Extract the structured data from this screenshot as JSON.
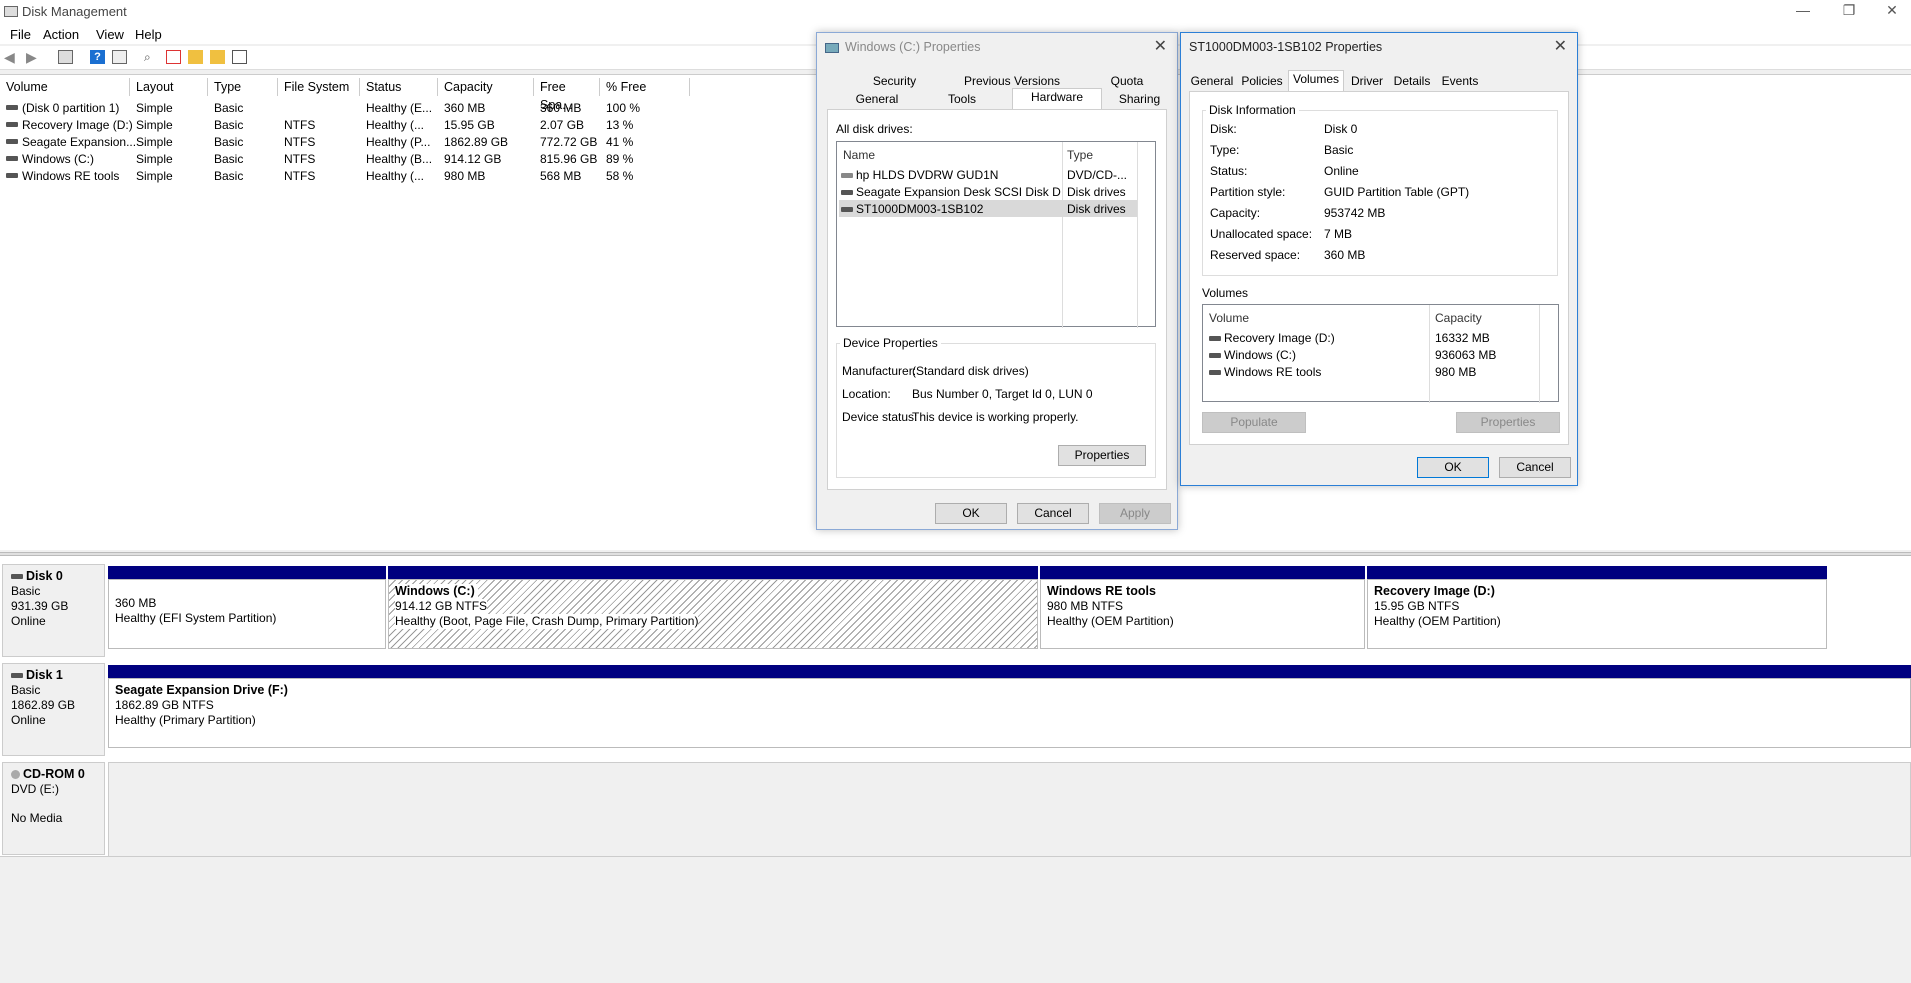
{
  "window": {
    "title": "Disk Management",
    "controls": [
      "—",
      "❐",
      "✕"
    ]
  },
  "menu": [
    "File",
    "Action",
    "View",
    "Help"
  ],
  "volume_list": {
    "headers": [
      "Volume",
      "Layout",
      "Type",
      "File System",
      "Status",
      "Capacity",
      "Free Spa...",
      "% Free"
    ],
    "rows": [
      [
        "(Disk 0 partition 1)",
        "Simple",
        "Basic",
        "",
        "Healthy (E...",
        "360 MB",
        "360 MB",
        "100 %"
      ],
      [
        "Recovery Image (D:)",
        "Simple",
        "Basic",
        "NTFS",
        "Healthy (...",
        "15.95 GB",
        "2.07 GB",
        "13 %"
      ],
      [
        "Seagate Expansion...",
        "Simple",
        "Basic",
        "NTFS",
        "Healthy (P...",
        "1862.89 GB",
        "772.72 GB",
        "41 %"
      ],
      [
        "Windows (C:)",
        "Simple",
        "Basic",
        "NTFS",
        "Healthy (B...",
        "914.12 GB",
        "815.96 GB",
        "89 %"
      ],
      [
        "Windows RE tools",
        "Simple",
        "Basic",
        "NTFS",
        "Healthy (...",
        "980 MB",
        "568 MB",
        "58 %"
      ]
    ]
  },
  "disks": {
    "disk0": {
      "name": "Disk 0",
      "type": "Basic",
      "size": "931.39 GB",
      "status": "Online",
      "partitions": [
        {
          "title": "",
          "size": "360 MB",
          "status": "Healthy (EFI System Partition)"
        },
        {
          "title": "Windows  (C:)",
          "size": "914.12 GB NTFS",
          "status": "Healthy (Boot, Page File, Crash Dump, Primary Partition)"
        },
        {
          "title": "Windows RE tools",
          "size": "980 MB NTFS",
          "status": "Healthy (OEM Partition)"
        },
        {
          "title": "Recovery Image  (D:)",
          "size": "15.95 GB NTFS",
          "status": "Healthy (OEM Partition)"
        }
      ]
    },
    "disk1": {
      "name": "Disk 1",
      "type": "Basic",
      "size": "1862.89 GB",
      "status": "Online",
      "partitions": [
        {
          "title": "Seagate Expansion Drive  (F:)",
          "size": "1862.89 GB NTFS",
          "status": "Healthy (Primary Partition)"
        }
      ]
    },
    "cdrom0": {
      "name": "CD-ROM 0",
      "type": "DVD (E:)",
      "status": "No Media"
    }
  },
  "dlg_c": {
    "title": "Windows (C:) Properties",
    "tabs_top": [
      "Security",
      "Previous Versions",
      "Quota"
    ],
    "tabs_bottom": [
      "General",
      "Tools",
      "Hardware",
      "Sharing"
    ],
    "all_drives_label": "All disk drives:",
    "headers": [
      "Name",
      "Type"
    ],
    "drives": [
      [
        "hp HLDS DVDRW  GUD1N",
        "DVD/CD-..."
      ],
      [
        "Seagate Expansion Desk SCSI Disk De...",
        "Disk drives"
      ],
      [
        "ST1000DM003-1SB102",
        "Disk drives"
      ]
    ],
    "device_props_label": "Device Properties",
    "manufacturer_label": "Manufacturer:",
    "manufacturer": "(Standard disk drives)",
    "location_label": "Location:",
    "location": "Bus Number 0, Target Id 0, LUN 0",
    "status_label": "Device status:",
    "status": "This device is working properly.",
    "properties_btn": "Properties",
    "ok": "OK",
    "cancel": "Cancel",
    "apply": "Apply"
  },
  "dlg_st": {
    "title": "ST1000DM003-1SB102 Properties",
    "tabs": [
      "General",
      "Policies",
      "Volumes",
      "Driver",
      "Details",
      "Events"
    ],
    "disk_info_label": "Disk Information",
    "info": [
      [
        "Disk:",
        "Disk 0"
      ],
      [
        "Type:",
        "Basic"
      ],
      [
        "Status:",
        "Online"
      ],
      [
        "Partition style:",
        "GUID Partition Table (GPT)"
      ],
      [
        "Capacity:",
        "953742 MB"
      ],
      [
        "Unallocated space:",
        "7 MB"
      ],
      [
        "Reserved space:",
        "360 MB"
      ]
    ],
    "volumes_label": "Volumes",
    "vol_headers": [
      "Volume",
      "Capacity"
    ],
    "volumes": [
      [
        "Recovery Image (D:)",
        "16332 MB"
      ],
      [
        "Windows (C:)",
        "936063 MB"
      ],
      [
        "Windows RE tools",
        "980 MB"
      ]
    ],
    "populate_btn": "Populate",
    "properties_btn": "Properties",
    "ok": "OK",
    "cancel": "Cancel"
  }
}
